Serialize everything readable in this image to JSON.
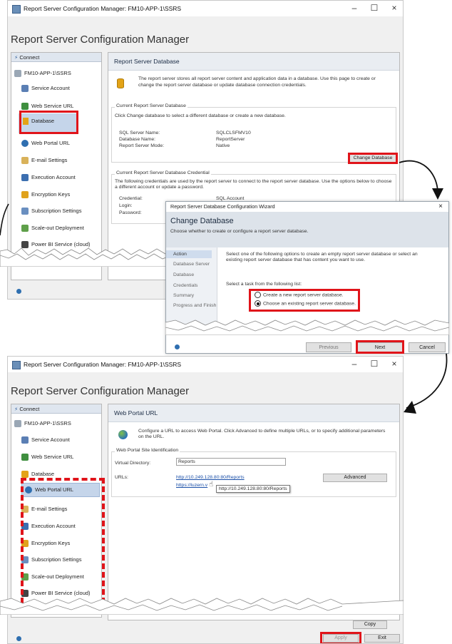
{
  "top": {
    "window_title": "Report Server Configuration Manager: FM10-APP-1\\SSRS",
    "app_title": "Report Server Configuration Manager",
    "connect_label": "Connect",
    "server_label": "FM10-APP-1\\SSRS",
    "nav": [
      "Service Account",
      "Web Service URL",
      "Database",
      "Web Portal URL",
      "E-mail Settings",
      "Execution Account",
      "Encryption Keys",
      "Subscription Settings",
      "Scale-out Deployment",
      "Power BI Service (cloud)"
    ],
    "panel_title": "Report Server Database",
    "intro": "The report server stores all report server content and application data in a database. Use this page to create or change the report server database or update database connection credentials.",
    "current_db_title": "Current Report Server Database",
    "current_db_hint": "Click Change database to select a different database or create a new database.",
    "sql_server_label": "SQL Server Name:",
    "sql_server_value": "SQLCLSFMV10",
    "db_name_label": "Database Name:",
    "db_name_value": "ReportServer",
    "mode_label": "Report Server Mode:",
    "mode_value": "Native",
    "change_db_button": "Change Database",
    "cred_title": "Current Report Server Database Credential",
    "cred_hint": "The following credentials are used by the report server to connect to the report server database. Use the options below to choose a different account or update a password.",
    "credential_label": "Credential:",
    "credential_value": "SQL Account",
    "login_label": "Login:",
    "password_label": "Password:"
  },
  "wizard": {
    "title": "Report Server Database Configuration Wizard",
    "close": "×",
    "heading": "Change Database",
    "subheading": "Choose whether to create or configure a report server database.",
    "steps": [
      "Action",
      "Database Server",
      "Database",
      "Credentials",
      "Summary",
      "Progress and Finish"
    ],
    "description": "Select one of the following options to create an empty report server database or select an existing report server database that has content you want to use.",
    "task_prompt": "Select a task from the following list:",
    "option_create": "Create a new report server database.",
    "option_existing": "Choose an existing report server database.",
    "previous_button": "Previous",
    "next_button": "Next",
    "cancel_button": "Cancel"
  },
  "bottom": {
    "window_title": "Report Server Configuration Manager: FM10-APP-1\\SSRS",
    "app_title": "Report Server Configuration Manager",
    "connect_label": "Connect",
    "server_label": "FM10-APP-1\\SSRS",
    "nav": [
      "Service Account",
      "Web Service URL",
      "Database",
      "Web Portal URL",
      "E-mail Settings",
      "Execution Account",
      "Encryption Keys",
      "Subscription Settings",
      "Scale-out Deployment",
      "Power BI Service (cloud)"
    ],
    "panel_title": "Web Portal URL",
    "intro": "Configure a URL to access Web Portal. Click Advanced to define multiple URLs, or to specify additional parameters on the URL.",
    "site_id_title": "Web Portal Site Identification",
    "vdir_label": "Virtual Directory:",
    "vdir_value": "Reports",
    "urls_label": "URLs:",
    "url1": "http://10.249.128.80:80/Reports",
    "url2": "https://luzern.v",
    "tooltip": "http://10.249.128.80:80/Reports",
    "advanced_button": "Advanced",
    "copy_button": "Copy",
    "apply_button": "Apply",
    "exit_button": "Exit"
  },
  "window_controls": {
    "minimize": "–",
    "maximize": "☐",
    "close": "×"
  },
  "colors": {
    "highlight_red": "#e0141a",
    "selected_nav": "#c5d5ea",
    "accent_blue": "#1a4fa8"
  }
}
